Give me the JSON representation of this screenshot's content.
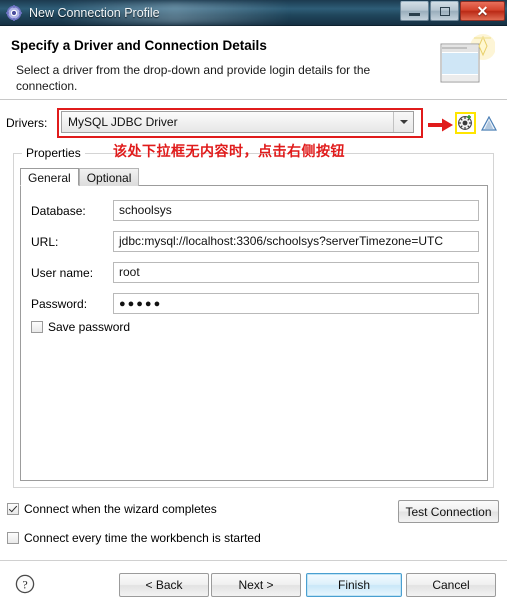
{
  "window": {
    "title": "New Connection Profile",
    "icon": "connection-profile-gear-icon",
    "minimize_label": "Minimize",
    "maximize_label": "Maximize",
    "close_label": "Close"
  },
  "header": {
    "title": "Specify a Driver and Connection Details",
    "description": "Select a driver from the drop-down and provide login details for the connection.",
    "banner_icon": "database-wizard-icon"
  },
  "drivers": {
    "label": "Drivers:",
    "selected": "MySQL JDBC Driver",
    "new_driver_icon": "new-driver-definition-icon",
    "edit_driver_icon": "warning-triangle-icon",
    "highlight_color": "#e01b1b",
    "highlight_button_color": "#ffe500"
  },
  "annotation": {
    "text": "该处下拉框无内容时，点击右侧按钮",
    "color": "#e01b1b"
  },
  "properties": {
    "legend": "Properties",
    "tabs": [
      {
        "label": "General",
        "active": true
      },
      {
        "label": "Optional",
        "active": false
      }
    ],
    "fields": [
      {
        "label": "Database:",
        "value": "schoolsys",
        "type": "text"
      },
      {
        "label": "URL:",
        "value": "jdbc:mysql://localhost:3306/schoolsys?serverTimezone=UTC",
        "type": "text"
      },
      {
        "label": "User name:",
        "value": "root",
        "type": "text"
      },
      {
        "label": "Password:",
        "value": "●●●●●",
        "type": "password"
      }
    ],
    "save_password": {
      "label": "Save password",
      "checked": false
    }
  },
  "options": {
    "connect_on_finish": {
      "label": "Connect when the wizard completes",
      "checked": true
    },
    "connect_on_startup": {
      "label": "Connect every time the workbench is started",
      "checked": false
    },
    "test_connection_label": "Test Connection"
  },
  "footer": {
    "help_icon": "help-question-icon",
    "back_label": "< Back",
    "next_label": "Next >",
    "finish_label": "Finish",
    "cancel_label": "Cancel"
  }
}
